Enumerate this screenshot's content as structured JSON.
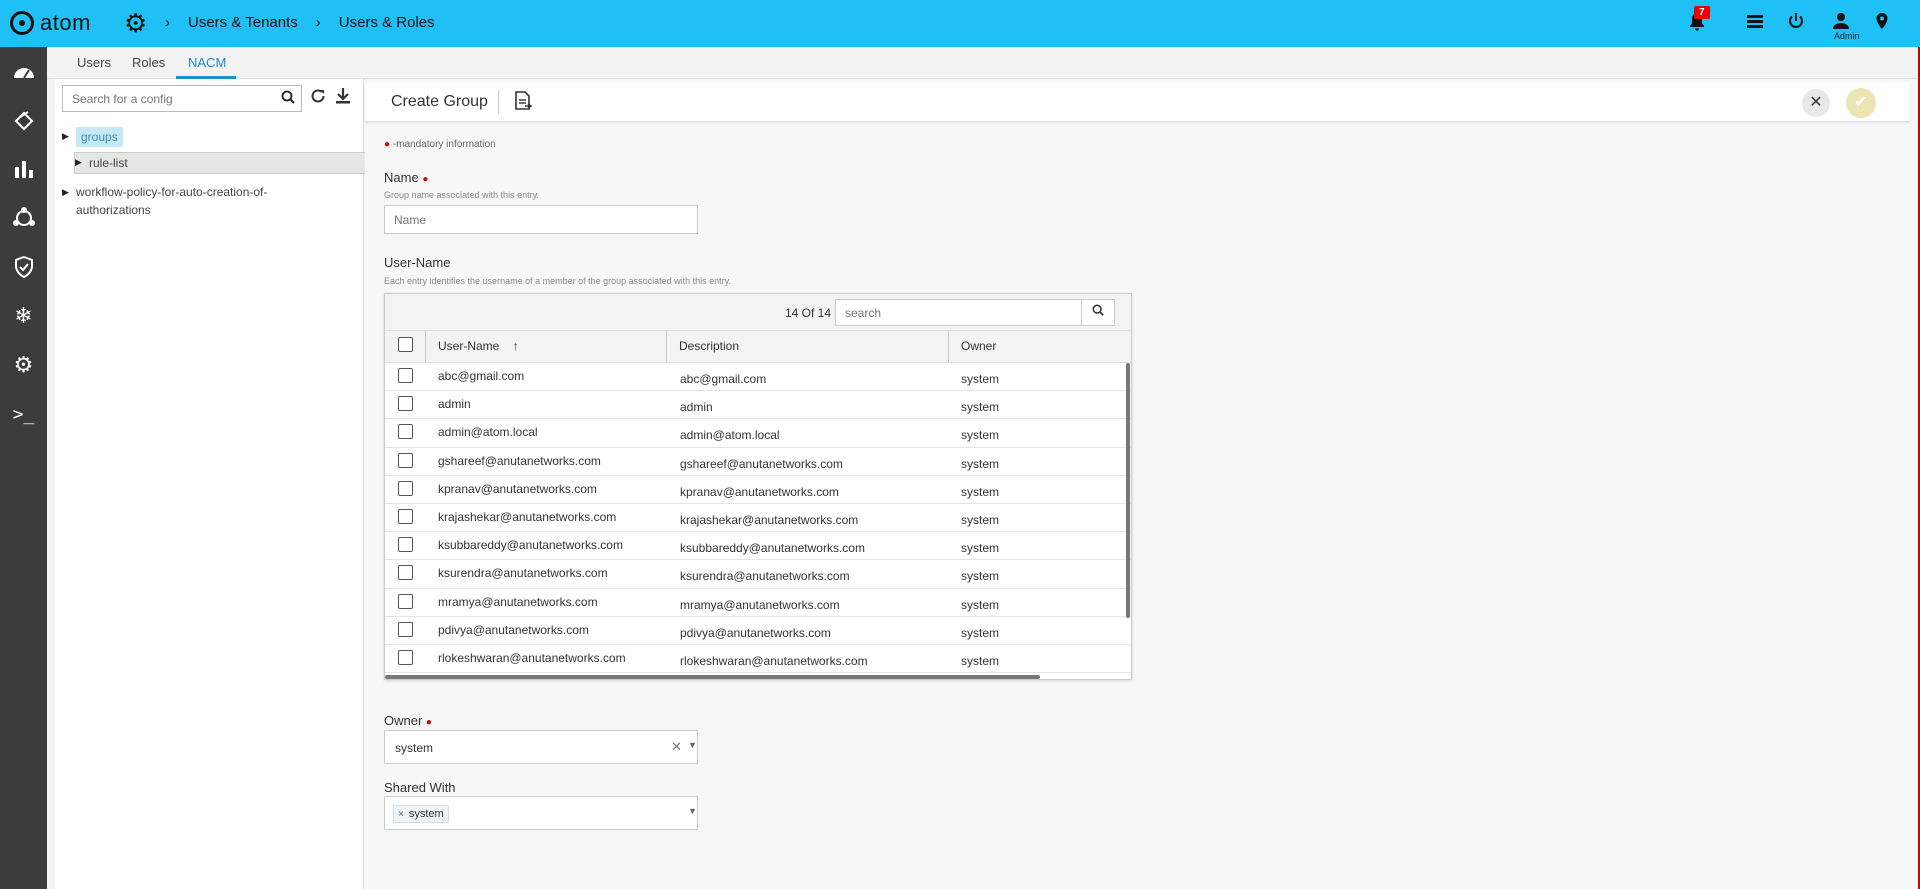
{
  "app": {
    "logo_text": "atom",
    "breadcrumbs": [
      "Users & Tenants",
      "Users & Roles"
    ],
    "notification_count": "7",
    "user_label": "Admin"
  },
  "tabs": [
    "Users",
    "Roles",
    "NACM"
  ],
  "active_tab": "NACM",
  "config_panel": {
    "search_placeholder": "Search for a config",
    "items": [
      {
        "label": "groups",
        "selected_tag": true
      },
      {
        "label": "rule-list",
        "selected_row": true
      },
      {
        "label": "workflow-policy-for-auto-creation-of-authorizations"
      }
    ]
  },
  "form": {
    "title": "Create Group",
    "mandatory_note": "-mandatory information",
    "name": {
      "label": "Name",
      "hint": "Group name associated with this entry.",
      "placeholder": "Name",
      "value": ""
    },
    "user_name": {
      "label": "User-Name",
      "hint": "Each entry identifies the username of a member of the group associated with this entry.",
      "count_text": "14 Of 14",
      "search_placeholder": "search",
      "columns": [
        "User-Name",
        "Description",
        "Owner"
      ],
      "rows": [
        {
          "user": "abc@gmail.com",
          "description": "abc@gmail.com",
          "owner": "system"
        },
        {
          "user": "admin",
          "description": "admin",
          "owner": "system"
        },
        {
          "user": "admin@atom.local",
          "description": "admin@atom.local",
          "owner": "system"
        },
        {
          "user": "gshareef@anutanetworks.com",
          "description": "gshareef@anutanetworks.com",
          "owner": "system"
        },
        {
          "user": "kpranav@anutanetworks.com",
          "description": "kpranav@anutanetworks.com",
          "owner": "system"
        },
        {
          "user": "krajashekar@anutanetworks.com",
          "description": "krajashekar@anutanetworks.com",
          "owner": "system"
        },
        {
          "user": "ksubbareddy@anutanetworks.com",
          "description": "ksubbareddy@anutanetworks.com",
          "owner": "system"
        },
        {
          "user": "ksurendra@anutanetworks.com",
          "description": "ksurendra@anutanetworks.com",
          "owner": "system"
        },
        {
          "user": "mramya@anutanetworks.com",
          "description": "mramya@anutanetworks.com",
          "owner": "system"
        },
        {
          "user": "pdivya@anutanetworks.com",
          "description": "pdivya@anutanetworks.com",
          "owner": "system"
        },
        {
          "user": "rlokeshwaran@anutanetworks.com",
          "description": "rlokeshwaran@anutanetworks.com",
          "owner": "system"
        }
      ]
    },
    "owner": {
      "label": "Owner",
      "value": "system"
    },
    "shared_with": {
      "label": "Shared With",
      "chips": [
        "system"
      ]
    }
  },
  "colors": {
    "topbar": "#1ec0f5",
    "leftnav": "#3c3c3c",
    "accent": "#1a8fc9",
    "badge": "#ee0000",
    "required_dot": "#dd0000"
  },
  "icons": [
    "atom-logo-icon",
    "settings-gear-icon",
    "chevron-right-icon",
    "bell-icon",
    "list-icon",
    "power-icon",
    "user-icon",
    "location-pin-icon",
    "dashboard-icon",
    "devices-icon",
    "bar-chart-icon",
    "network-icon",
    "shield-check-icon",
    "snowflake-icon",
    "gear-icon",
    "terminal-icon",
    "search-icon",
    "refresh-icon",
    "download-icon",
    "document-icon",
    "close-icon",
    "check-icon",
    "sort-arrow-up-icon"
  ]
}
